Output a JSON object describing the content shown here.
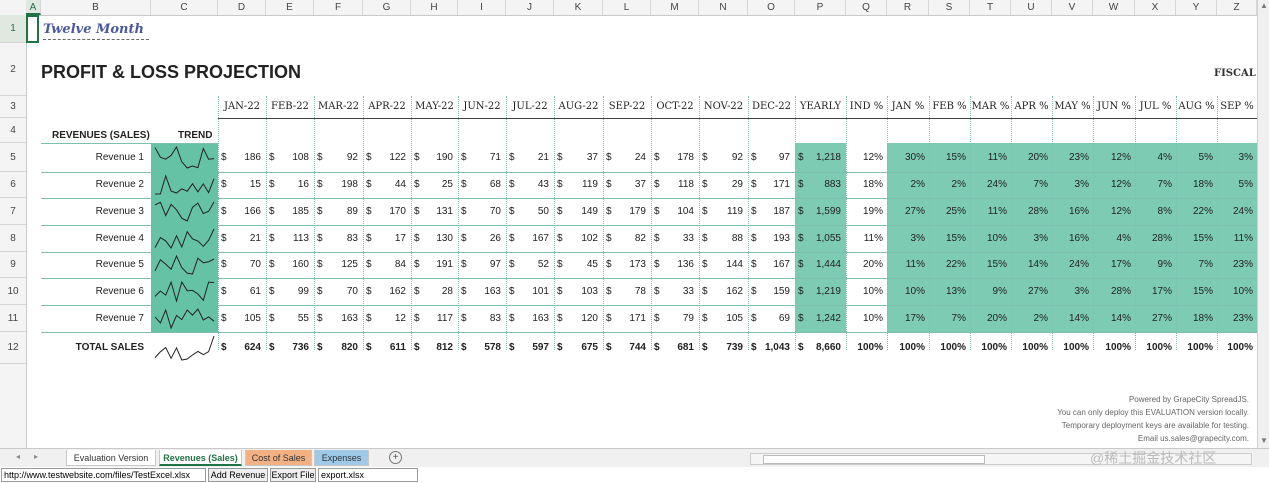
{
  "columns": [
    "A",
    "B",
    "C",
    "D",
    "E",
    "F",
    "G",
    "H",
    "I",
    "J",
    "K",
    "L",
    "M",
    "N",
    "O",
    "P",
    "Q",
    "R",
    "S",
    "T",
    "U",
    "V",
    "W",
    "X",
    "Y",
    "Z"
  ],
  "rows": [
    "1",
    "2",
    "3",
    "4",
    "5",
    "6",
    "7",
    "8",
    "9",
    "10",
    "11",
    "12"
  ],
  "sheet": {
    "title1": "Twelve Month",
    "title2": "PROFIT & LOSS PROJECTION",
    "fiscal": "FISCAL",
    "months": [
      "JAN-22",
      "FEB-22",
      "MAR-22",
      "APR-22",
      "MAY-22",
      "JUN-22",
      "JUL-22",
      "AUG-22",
      "SEP-22",
      "OCT-22",
      "NOV-22",
      "DEC-22"
    ],
    "yearly": "YEARLY",
    "ind": "IND %",
    "pct_headers": [
      "JAN %",
      "FEB %",
      "MAR %",
      "APR %",
      "MAY %",
      "JUN %",
      "JUL %",
      "AUG %",
      "SEP %"
    ],
    "rev_header": "REVENUES (SALES)",
    "trend_header": "TREND",
    "currency": "$",
    "revenues": [
      {
        "name": "Revenue 1",
        "values": [
          186,
          108,
          92,
          122,
          190,
          71,
          21,
          37,
          24,
          178,
          92,
          97
        ],
        "yearly": "1,218",
        "ind": "12%",
        "pcts": [
          "30%",
          "15%",
          "11%",
          "20%",
          "23%",
          "12%",
          "4%",
          "5%",
          "3%"
        ]
      },
      {
        "name": "Revenue 2",
        "values": [
          15,
          16,
          198,
          44,
          25,
          68,
          43,
          119,
          37,
          118,
          29,
          171
        ],
        "yearly": "883",
        "ind": "18%",
        "pcts": [
          "2%",
          "2%",
          "24%",
          "7%",
          "3%",
          "12%",
          "7%",
          "18%",
          "5%"
        ]
      },
      {
        "name": "Revenue 3",
        "values": [
          166,
          185,
          89,
          170,
          131,
          70,
          50,
          149,
          179,
          104,
          119,
          187
        ],
        "yearly": "1,599",
        "ind": "19%",
        "pcts": [
          "27%",
          "25%",
          "11%",
          "28%",
          "16%",
          "12%",
          "8%",
          "22%",
          "24%"
        ]
      },
      {
        "name": "Revenue 4",
        "values": [
          21,
          113,
          83,
          17,
          130,
          26,
          167,
          102,
          82,
          33,
          88,
          193
        ],
        "yearly": "1,055",
        "ind": "11%",
        "pcts": [
          "3%",
          "15%",
          "10%",
          "3%",
          "16%",
          "4%",
          "28%",
          "15%",
          "11%"
        ]
      },
      {
        "name": "Revenue 5",
        "values": [
          70,
          160,
          125,
          84,
          191,
          97,
          52,
          45,
          173,
          136,
          144,
          167
        ],
        "yearly": "1,444",
        "ind": "20%",
        "pcts": [
          "11%",
          "22%",
          "15%",
          "14%",
          "24%",
          "17%",
          "9%",
          "7%",
          "23%"
        ]
      },
      {
        "name": "Revenue 6",
        "values": [
          61,
          99,
          70,
          162,
          28,
          163,
          101,
          103,
          78,
          33,
          162,
          159
        ],
        "yearly": "1,219",
        "ind": "10%",
        "pcts": [
          "10%",
          "13%",
          "9%",
          "27%",
          "3%",
          "28%",
          "17%",
          "15%",
          "10%"
        ]
      },
      {
        "name": "Revenue 7",
        "values": [
          105,
          55,
          163,
          12,
          117,
          83,
          163,
          120,
          171,
          79,
          105,
          69
        ],
        "yearly": "1,242",
        "ind": "10%",
        "pcts": [
          "17%",
          "7%",
          "20%",
          "2%",
          "14%",
          "14%",
          "27%",
          "18%",
          "23%"
        ]
      }
    ],
    "total": {
      "name": "TOTAL SALES",
      "values": [
        "624",
        "736",
        "820",
        "611",
        "812",
        "578",
        "597",
        "675",
        "744",
        "681",
        "739",
        "1,043"
      ],
      "yearly": "8,660",
      "ind": "100%",
      "pcts": [
        "100%",
        "100%",
        "100%",
        "100%",
        "100%",
        "100%",
        "100%",
        "100%",
        "100%"
      ]
    }
  },
  "watermark": [
    "Powered by GrapeCity SpreadJS.",
    "You can only deploy this EVALUATION version locally.",
    "Temporary deployment keys are available for testing.",
    "Email us.sales@grapecity.com."
  ],
  "site_watermark": "@稀土掘金技术社区",
  "tabs": [
    {
      "label": "Evaluation Version",
      "color": "#ffffff",
      "active": false
    },
    {
      "label": "Revenues (Sales)",
      "color": "#ffffff",
      "active": true
    },
    {
      "label": "Cost of Sales",
      "color": "#f2b183",
      "active": false
    },
    {
      "label": "Expenses",
      "color": "#9ec9e8",
      "active": false
    }
  ],
  "add_sheet_icon": "plus-circle-icon",
  "toolbar": {
    "url_value": "http://www.testwebsite.com/files/TestExcel.xlsx",
    "add_revenue": "Add Revenue",
    "export_file": "Export File",
    "export_name": "export.xlsx"
  },
  "colors": {
    "teal": "#66c2a5",
    "accent": "#217346"
  }
}
